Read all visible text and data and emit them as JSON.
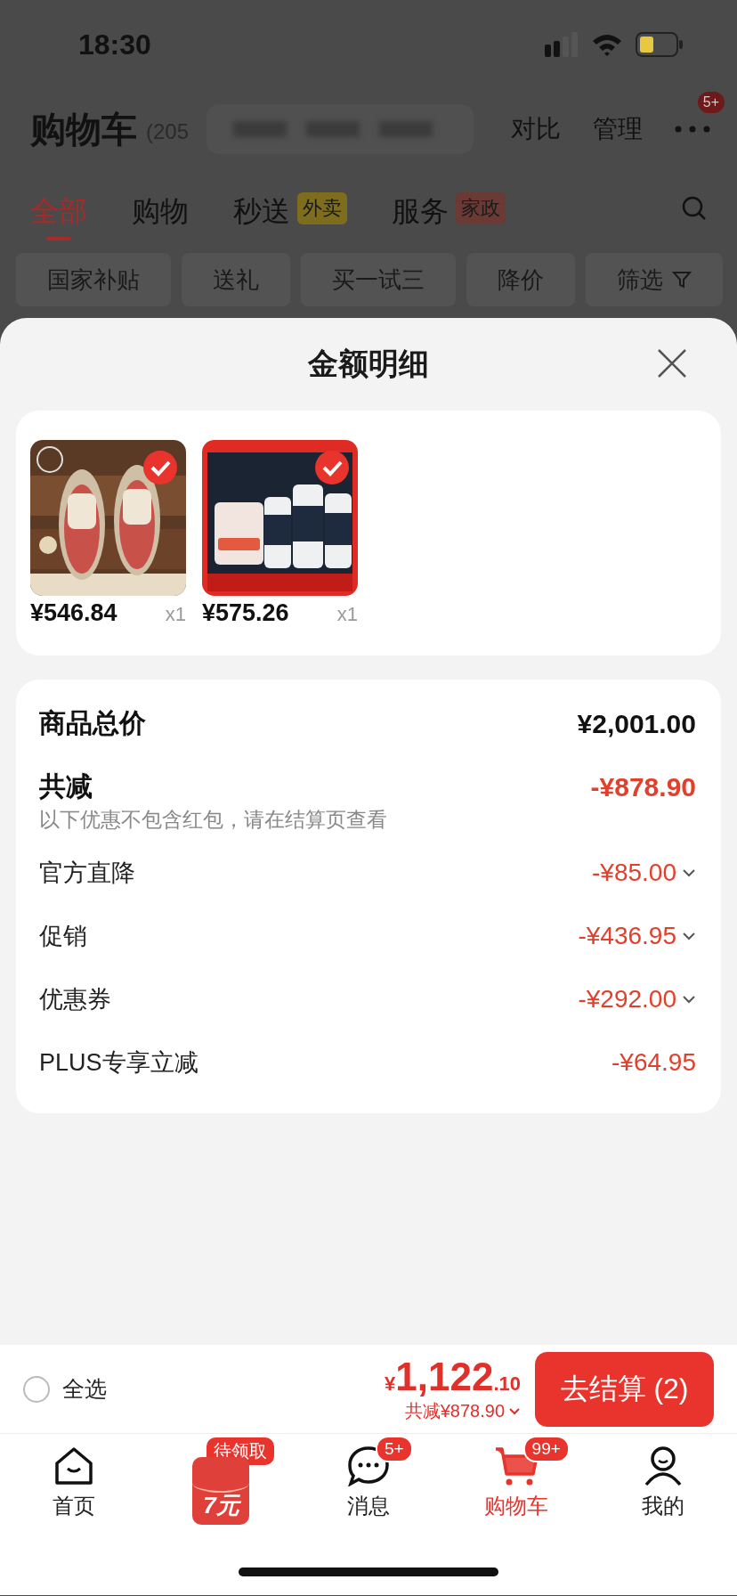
{
  "status_bar": {
    "time": "18:30"
  },
  "header": {
    "title": "购物车",
    "count": "(205",
    "actions": [
      "对比",
      "管理"
    ],
    "more_badge": "5+"
  },
  "category_tabs": [
    {
      "label": "全部",
      "selected": true
    },
    {
      "label": "购物",
      "selected": false
    },
    {
      "label": "秒送",
      "selected": false,
      "badge": "外卖",
      "color": "#7d6d1c"
    },
    {
      "label": "服务",
      "selected": false,
      "badge": "家政",
      "color": "#6b3a34"
    }
  ],
  "filter_chips": [
    {
      "label": "国家补贴",
      "kind": "chip"
    },
    {
      "label": "送礼",
      "kind": "chip"
    },
    {
      "label": "买一试三",
      "kind": "chip"
    },
    {
      "label": "降价",
      "kind": "chip"
    },
    {
      "label": "筛选",
      "kind": "filter"
    }
  ],
  "sheet": {
    "title": "金额明细",
    "products": [
      {
        "kind": "picture",
        "checked": true,
        "price": "¥546.84",
        "quantity": "x1"
      },
      {
        "kind": "picture",
        "checked": true,
        "price": "¥575.26",
        "quantity": "x1"
      }
    ],
    "rows": [
      {
        "kind": "total",
        "label": "商品总价",
        "amount": "¥2,001.00"
      },
      {
        "kind": "discount_total",
        "label": "共减",
        "amount": "-¥878.90",
        "note": "以下优惠不包含红包，请在结算页查看"
      },
      {
        "kind": "detail",
        "label": "官方直降",
        "amount": "-¥85.00",
        "expandable": true
      },
      {
        "kind": "detail",
        "label": "促销",
        "amount": "-¥436.95",
        "expandable": true
      },
      {
        "kind": "detail",
        "label": "优惠券",
        "amount": "-¥292.00",
        "expandable": true
      },
      {
        "kind": "detail",
        "label": "PLUS专享立减",
        "amount": "-¥64.95",
        "expandable": false
      }
    ]
  },
  "checkout": {
    "select_all": {
      "label": "全选",
      "checked": false
    },
    "currency": "¥",
    "total_main": "1,122",
    "total_decimal": ".10",
    "discount": "共减¥878.90",
    "button": "去结算 (2)"
  },
  "bottom_nav": [
    {
      "kind": "home",
      "label": "首页",
      "selected": false
    },
    {
      "kind": "promo",
      "badge": "待领取",
      "text": "7元",
      "selected": false
    },
    {
      "kind": "messages",
      "label": "消息",
      "badge": "5+",
      "selected": false
    },
    {
      "kind": "cart",
      "label": "购物车",
      "badge": "99+",
      "selected": true
    },
    {
      "kind": "profile",
      "label": "我的",
      "selected": false
    }
  ]
}
